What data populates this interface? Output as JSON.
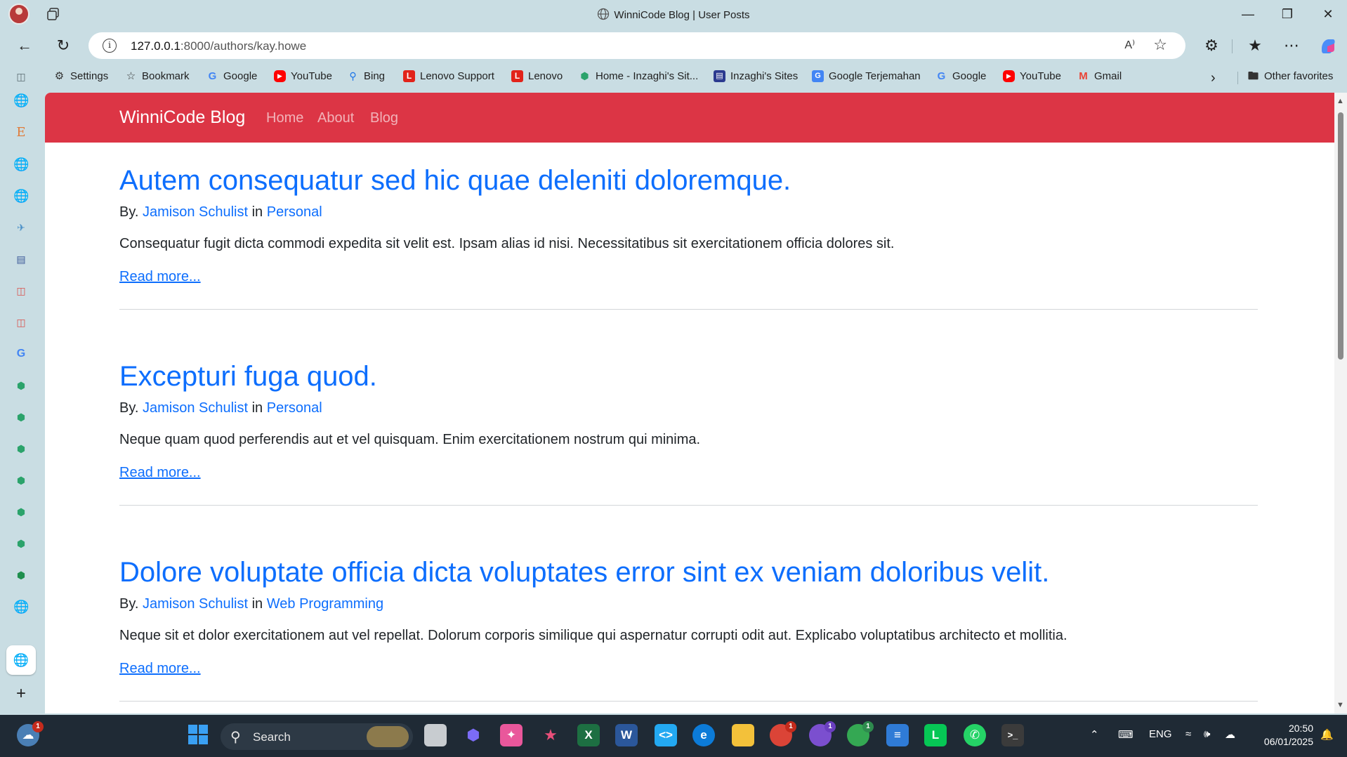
{
  "window": {
    "title": "WinniCode Blog | User Posts",
    "minimize": "—",
    "restore": "❐",
    "close": "✕"
  },
  "address": {
    "url_host": "127.0.0.1",
    "url_path": ":8000/authors/kay.howe",
    "info_icon": "i",
    "read_aloud": "A⁾"
  },
  "favorites": {
    "items": [
      {
        "label": "Settings",
        "icon": "gear-icon"
      },
      {
        "label": "Bookmark",
        "icon": "bookmark-icon"
      },
      {
        "label": "Google",
        "icon": "google-icon"
      },
      {
        "label": "YouTube",
        "icon": "youtube-icon"
      },
      {
        "label": "Bing",
        "icon": "bing-search-icon"
      },
      {
        "label": "Lenovo Support",
        "icon": "lenovo-icon"
      },
      {
        "label": "Lenovo",
        "icon": "lenovo-icon"
      },
      {
        "label": "Home - Inzaghi's Sit...",
        "icon": "site-icon"
      },
      {
        "label": "Inzaghi's Sites",
        "icon": "site-icon"
      },
      {
        "label": "Google Terjemahan",
        "icon": "translate-icon"
      },
      {
        "label": "Google",
        "icon": "google-icon"
      },
      {
        "label": "YouTube",
        "icon": "youtube-icon"
      },
      {
        "label": "Gmail",
        "icon": "gmail-icon"
      }
    ],
    "more": "›",
    "other_favorites": "Other favorites"
  },
  "site": {
    "brand": "WinniCode Blog",
    "nav": [
      "Home",
      "About",
      "Blog"
    ],
    "accent": "#dc3545",
    "link_color": "#0d6efd"
  },
  "posts": [
    {
      "title": "Autem consequatur sed hic quae deleniti doloremque.",
      "by_prefix": "By.",
      "author": "Jamison Schulist",
      "in_word": "in",
      "category": "Personal",
      "excerpt": "Consequatur fugit dicta commodi expedita sit velit est. Ipsam alias id nisi. Necessitatibus sit exercitationem officia dolores sit.",
      "read_more": "Read more..."
    },
    {
      "title": "Excepturi fuga quod.",
      "by_prefix": "By.",
      "author": "Jamison Schulist",
      "in_word": "in",
      "category": "Personal",
      "excerpt": "Neque quam quod perferendis aut et vel quisquam. Enim exercitationem nostrum qui minima.",
      "read_more": "Read more..."
    },
    {
      "title": "Dolore voluptate officia dicta voluptates error sint ex veniam doloribus velit.",
      "by_prefix": "By.",
      "author": "Jamison Schulist",
      "in_word": "in",
      "category": "Web Programming",
      "excerpt": "Neque sit et dolor exercitationem aut vel repellat. Dolorum corporis similique qui aspernatur corrupti odit aut. Explicabo voluptatibus architecto et mollitia.",
      "read_more": "Read more..."
    }
  ],
  "taskbar": {
    "search_label": "Search",
    "weather_badge": "1",
    "chrome_badges": [
      "1",
      "1",
      "1"
    ],
    "language": "ENG",
    "time": "20:50",
    "date": "06/01/2025"
  }
}
